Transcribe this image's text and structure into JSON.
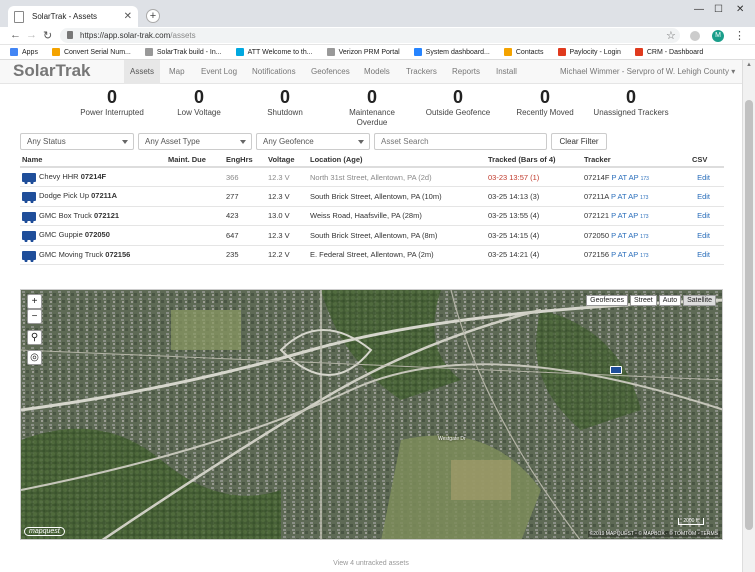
{
  "browser": {
    "tab_title": "SolarTrak - Assets",
    "url_host": "https://app.solar-trak.com",
    "url_path": "/assets",
    "profile_initial": "M",
    "bookmarks": [
      {
        "label": "Apps",
        "icon": "apps-grid-icon",
        "color": "#4285f4"
      },
      {
        "label": "Convert Serial Num...",
        "icon": "s-icon",
        "color": "#f4a300"
      },
      {
        "label": "SolarTrak build - In...",
        "icon": "page-icon",
        "color": "#999999"
      },
      {
        "label": "ATT Welcome to th...",
        "icon": "cloud-icon",
        "color": "#00a8e0"
      },
      {
        "label": "Verizon PRM Portal",
        "icon": "page-icon",
        "color": "#999999"
      },
      {
        "label": "System dashboard...",
        "icon": "arrow-icon",
        "color": "#2684ff"
      },
      {
        "label": "Contacts",
        "icon": "s-icon",
        "color": "#f4a300"
      },
      {
        "label": "Paylocity - Login",
        "icon": "circle-icon",
        "color": "#e03a1e"
      },
      {
        "label": "CRM - Dashboard",
        "icon": "circle-icon",
        "color": "#e03a1e"
      }
    ]
  },
  "app": {
    "brand": "SolarTrak",
    "nav": [
      "Assets",
      "Map",
      "Event Log",
      "Notifications",
      "Geofences",
      "Models",
      "Trackers",
      "Reports",
      "Install"
    ],
    "active_nav": "Assets",
    "user": "Michael Wimmer - Servpro of W. Lehigh County"
  },
  "counters": [
    {
      "value": "0",
      "label": "Power Interrupted",
      "label2": ""
    },
    {
      "value": "0",
      "label": "Low Voltage",
      "label2": ""
    },
    {
      "value": "0",
      "label": "Shutdown",
      "label2": ""
    },
    {
      "value": "0",
      "label": "Maintenance",
      "label2": "Overdue"
    },
    {
      "value": "0",
      "label": "Outside Geofence",
      "label2": ""
    },
    {
      "value": "0",
      "label": "Recently Moved",
      "label2": ""
    },
    {
      "value": "0",
      "label": "Unassigned Trackers",
      "label2": ""
    }
  ],
  "filters": {
    "status": "Any Status",
    "asset_type": "Any Asset Type",
    "geofence": "Any Geofence",
    "search_placeholder": "Asset Search",
    "clear_label": "Clear Filter"
  },
  "table": {
    "headers": [
      "Name",
      "Maint. Due",
      "EngHrs",
      "Voltage",
      "Location (Age)",
      "Tracked (Bars of 4)",
      "Tracker",
      "CSV"
    ],
    "rows": [
      {
        "name": "Chevy HHR",
        "id": "07214F",
        "maint": "",
        "enghrs": "366",
        "voltage": "12.3 V",
        "location": "North 31st Street, Allentown, PA (2d)",
        "tracked": "03-23 13:57 (1)",
        "tracker": "07214F",
        "stale": true,
        "action": "Edit"
      },
      {
        "name": "Dodge Pick Up",
        "id": "07211A",
        "maint": "",
        "enghrs": "277",
        "voltage": "12.3 V",
        "location": "South Brick Street, Allentown, PA (10m)",
        "tracked": "03-25 14:13 (3)",
        "tracker": "07211A",
        "stale": false,
        "action": "Edit"
      },
      {
        "name": "GMC Box Truck",
        "id": "072121",
        "maint": "",
        "enghrs": "423",
        "voltage": "13.0 V",
        "location": "Weiss Road, Haafsville, PA (28m)",
        "tracked": "03-25 13:55 (4)",
        "tracker": "072121",
        "stale": false,
        "action": "Edit"
      },
      {
        "name": "GMC Guppie",
        "id": "072050",
        "maint": "",
        "enghrs": "647",
        "voltage": "12.3 V",
        "location": "South Brick Street, Allentown, PA (8m)",
        "tracked": "03-25 14:15 (4)",
        "tracker": "072050",
        "stale": false,
        "action": "Edit"
      },
      {
        "name": "GMC Moving Truck",
        "id": "072156",
        "maint": "",
        "enghrs": "235",
        "voltage": "12.2 V",
        "location": "E. Federal Street, Allentown, PA (2m)",
        "tracked": "03-25 14:21 (4)",
        "tracker": "072156",
        "stale": false,
        "action": "Edit"
      }
    ],
    "tracker_links": [
      "P",
      "AT",
      "AP"
    ],
    "tracker_sub": "173"
  },
  "map": {
    "zoom_in": "+",
    "zoom_out": "−",
    "layers": [
      "Geofences",
      "Street",
      "Auto",
      "Satellite"
    ],
    "active_layer": "Satellite",
    "attribution": "©2019 MAPQUEST · © MAPBOX · © TOMTOM · TERMS",
    "scale": "2000 ft",
    "logo": "mapquest",
    "place_label": "Westgate Dr"
  },
  "footer": "View 4 untracked assets",
  "colors": {
    "link": "#2a6ebb",
    "stale": "#c0392b",
    "truck": "#1f4e9a"
  }
}
